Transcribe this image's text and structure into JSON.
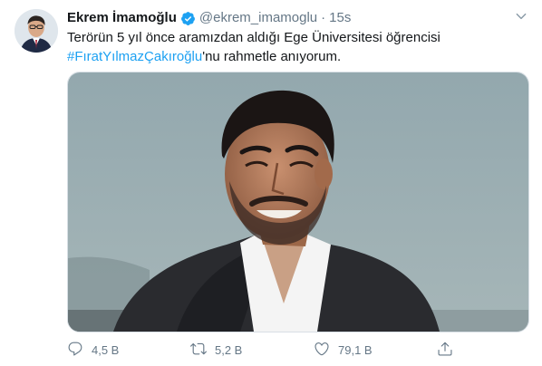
{
  "colors": {
    "link": "#1da1f2",
    "secondary_text": "#657786",
    "verified": "#1da1f2"
  },
  "tweet": {
    "author": {
      "display_name": "Ekrem İmamoğlu",
      "handle": "@ekrem_imamoglu",
      "verified_icon": "verified-badge-icon"
    },
    "separator": "·",
    "timestamp": "15s",
    "text": {
      "line1": "Terörün 5 yıl önce aramızdan aldığı Ege Üniversitesi öğrencisi",
      "hashtag": "#FıratYılmazÇakıroğlu",
      "rest": "'nu rahmetle anıyorum."
    },
    "media": {
      "description_icon": "photo"
    },
    "actions": {
      "reply": {
        "icon": "reply-icon",
        "count": "4,5 B"
      },
      "retweet": {
        "icon": "retweet-icon",
        "count": "5,2 B"
      },
      "like": {
        "icon": "like-icon",
        "count": "79,1 B"
      },
      "share": {
        "icon": "share-icon"
      }
    },
    "more_icon": "chevron-down-icon"
  }
}
